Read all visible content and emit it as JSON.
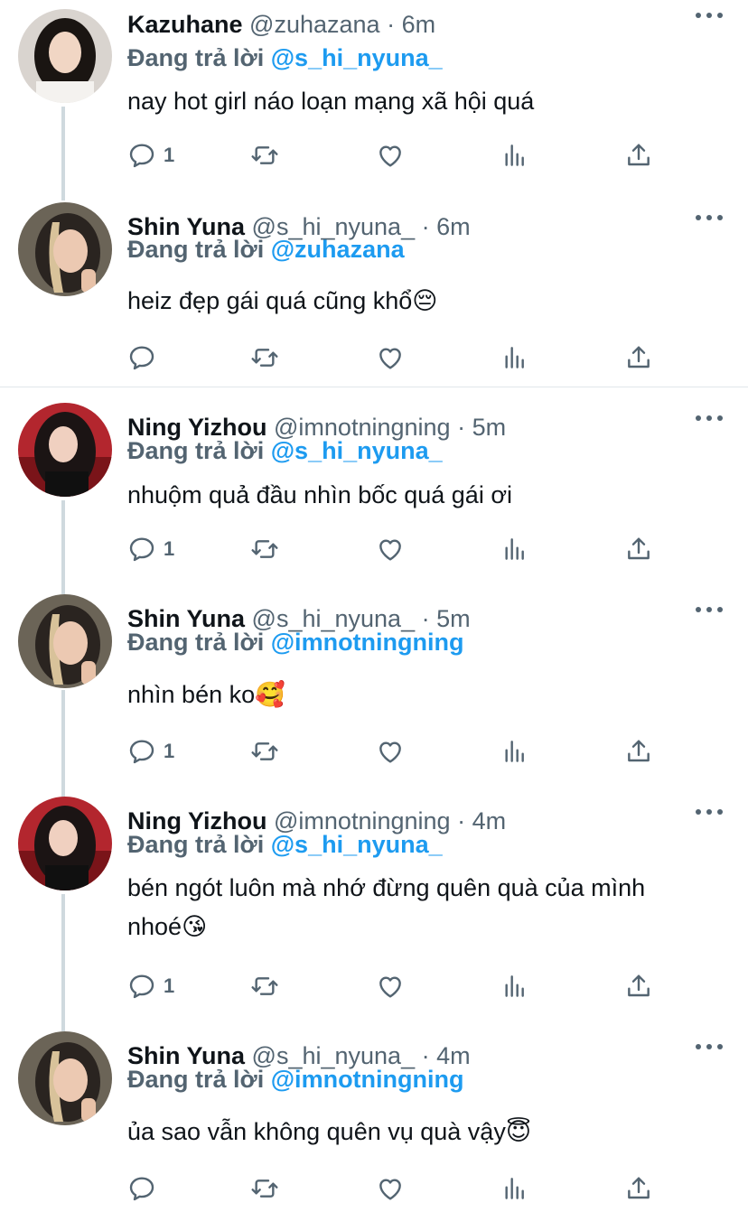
{
  "reply_prefix": "Đang trả lời",
  "tweets": [
    {
      "name": "Kazuhane",
      "handle": "@zuhazana",
      "dot": "·",
      "time": "6m",
      "mention": "@s_hi_nyuna_",
      "text": "nay hot girl náo loạn mạng xã hội quá",
      "reply_count": "1",
      "avatar": "avatar-kazuhane"
    },
    {
      "name": "Shin Yuna",
      "handle": "@s_hi_nyuna_",
      "dot": "·",
      "time": "6m",
      "mention": "@zuhazana",
      "text": "heiz đẹp gái quá cũng khổ😔",
      "reply_count": "",
      "avatar": "avatar-shin-yuna"
    },
    {
      "name": "Ning Yizhou",
      "handle": "@imnotningning",
      "dot": "·",
      "time": "5m",
      "mention": "@s_hi_nyuna_",
      "text": "nhuộm quả đầu nhìn bốc quá gái ơi",
      "reply_count": "1",
      "avatar": "avatar-ning-yizhou"
    },
    {
      "name": "Shin Yuna",
      "handle": "@s_hi_nyuna_",
      "dot": "·",
      "time": "5m",
      "mention": "@imnotningning",
      "text": "nhìn bén ko🥰",
      "reply_count": "1",
      "avatar": "avatar-shin-yuna"
    },
    {
      "name": "Ning Yizhou",
      "handle": "@imnotningning",
      "dot": "·",
      "time": "4m",
      "mention": "@s_hi_nyuna_",
      "text": "bén ngót luôn mà nhớ đừng quên quà của mình nhoé😘",
      "reply_count": "1",
      "avatar": "avatar-ning-yizhou"
    },
    {
      "name": "Shin Yuna",
      "handle": "@s_hi_nyuna_",
      "dot": "·",
      "time": "4m",
      "mention": "@imnotningning",
      "text": "ủa sao vẫn không quên vụ quà vậy😇",
      "reply_count": "",
      "avatar": "avatar-shin-yuna"
    }
  ],
  "icons": [
    "reply-icon",
    "retweet-icon",
    "like-icon",
    "analytics-icon",
    "share-icon",
    "more-icon"
  ],
  "colors": {
    "mention": "#1d9bf0",
    "secondary": "#536471",
    "line": "#cfd9de"
  }
}
